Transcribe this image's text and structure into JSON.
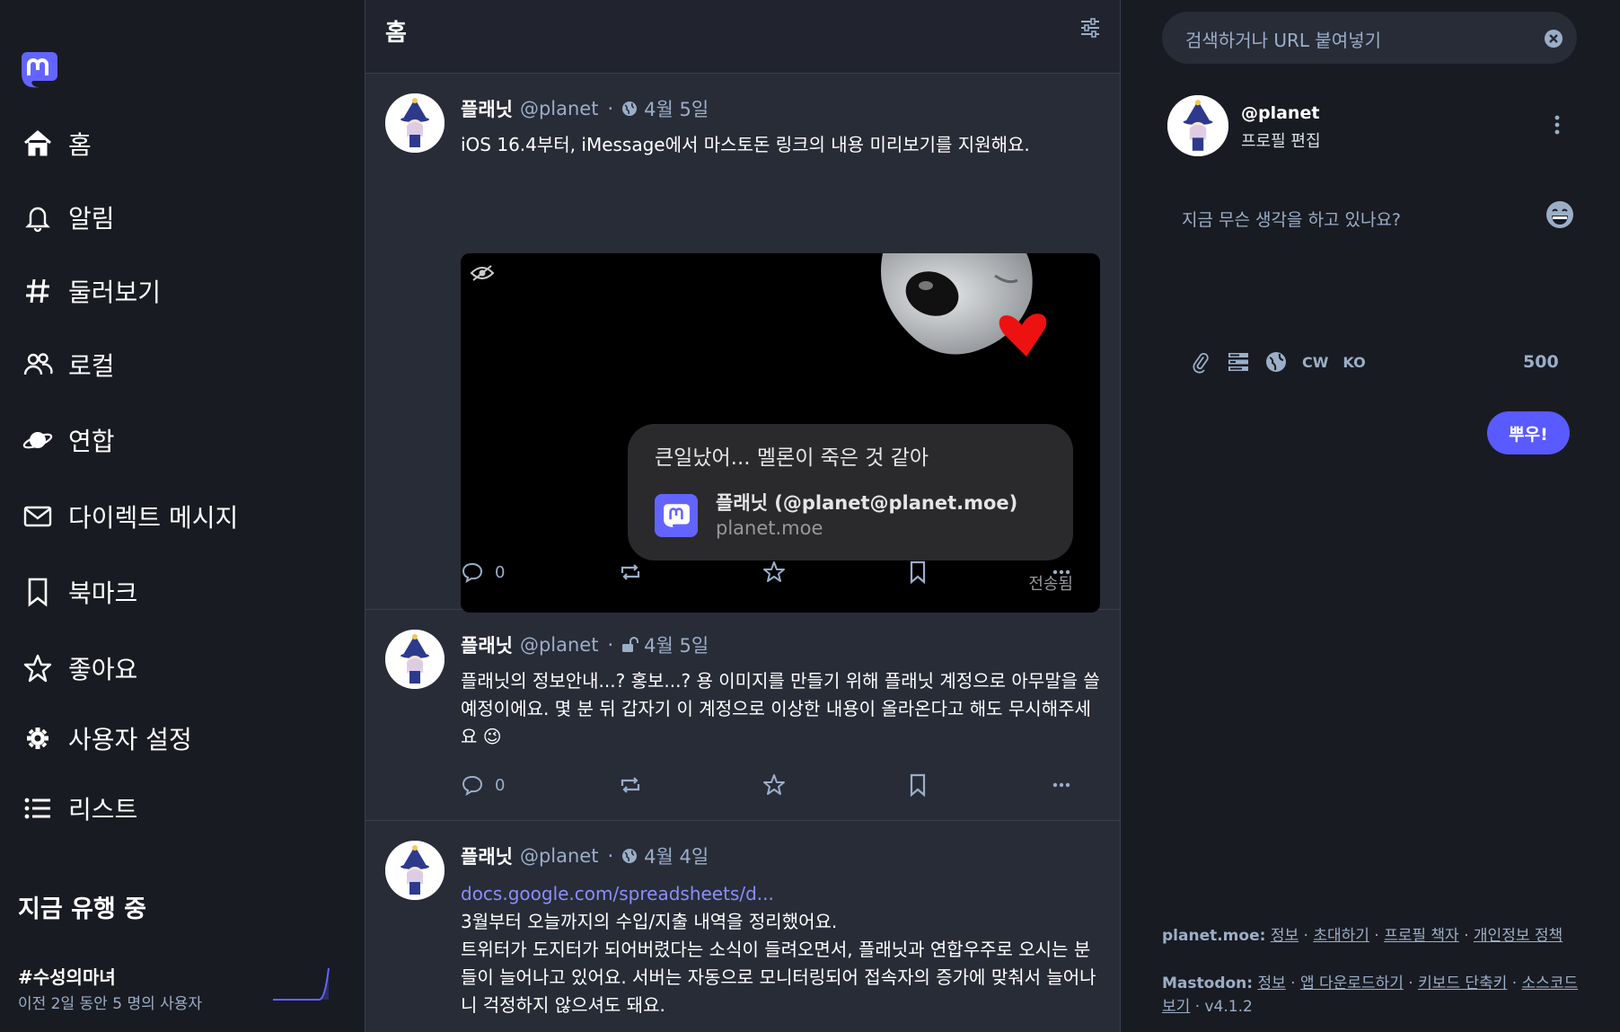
{
  "nav": {
    "items": [
      {
        "label": "홈",
        "icon": "home-icon"
      },
      {
        "label": "알림",
        "icon": "bell-icon"
      },
      {
        "label": "둘러보기",
        "icon": "hashtag-icon"
      },
      {
        "label": "로컬",
        "icon": "users-icon"
      },
      {
        "label": "연합",
        "icon": "planet-icon"
      },
      {
        "label": "다이렉트 메시지",
        "icon": "envelope-icon"
      },
      {
        "label": "북마크",
        "icon": "bookmark-icon"
      },
      {
        "label": "좋아요",
        "icon": "star-icon"
      },
      {
        "label": "사용자 설정",
        "icon": "gear-icon"
      },
      {
        "label": "리스트",
        "icon": "list-icon"
      }
    ]
  },
  "trending": {
    "title": "지금 유행 중",
    "tag": "#수성의마녀",
    "sub": "이전 2일 동안 5 명의 사용자"
  },
  "column": {
    "title": "홈"
  },
  "statuses": [
    {
      "name": "플래닛",
      "handle": "@planet",
      "dot": "·",
      "visibility": "public",
      "date": "4월 5일",
      "body": "iOS 16.4부터, iMessage에서 마스토돈 링크의 내용 미리보기를 지원해요.",
      "media": {
        "bubble_text": "큰일났어... 멜론이 죽은 것 같아",
        "card_title": "플래닛 (@planet@planet.moe)",
        "card_domain": "planet.moe",
        "delivered": "전송됨"
      },
      "replies": "0"
    },
    {
      "name": "플래닛",
      "handle": "@planet",
      "dot": "·",
      "visibility": "unlisted",
      "date": "4월 5일",
      "body": "플래닛의 정보안내...? 홍보...? 용 이미지를 만들기 위해 플래닛 계정으로 아무말을 쓸 예정이에요. 몇 분 뒤 갑자기 이 계정으로 이상한 내용이 올라온다고 해도 무시해주세요 😉",
      "replies": "0"
    },
    {
      "name": "플래닛",
      "handle": "@planet",
      "dot": "·",
      "visibility": "public",
      "date": "4월 4일",
      "link": "docs.google.com/spreadsheets/d...",
      "line1": "3월부터 오늘까지의 수입/지출 내역을 정리했어요.",
      "line2": "트위터가 도지터가 되어버렸다는 소식이 들려오면서, 플래닛과 연합우주로 오시는 분들이 늘어나고 있어요. 서버는 자동으로 모니터링되어 접속자의 증가에 맞춰서 늘어나니 걱정하지 않으셔도 돼요."
    }
  ],
  "search": {
    "placeholder": "검색하거나 URL 붙여넣기"
  },
  "me": {
    "handle": "@planet",
    "edit": "프로필 편집"
  },
  "compose": {
    "placeholder": "지금 무슨 생각을 하고 있나요?",
    "cw": "CW",
    "lang": "KO",
    "counter": "500",
    "publish": "뿌우!"
  },
  "footer": {
    "server": "planet.moe:",
    "server_links": [
      "정보",
      "초대하기",
      "프로필 책자",
      "개인정보 정책"
    ],
    "mastodon": "Mastodon:",
    "mastodon_links": [
      "정보",
      "앱 다운로드하기",
      "키보드 단축키",
      "소스코드 보기"
    ],
    "version": "v4.1.2",
    "sep": "·"
  },
  "colors": {
    "accent": "#595aff",
    "link": "#8c8dff",
    "muted": "#9baec8",
    "bg": "#191b22",
    "column": "#282c37"
  }
}
